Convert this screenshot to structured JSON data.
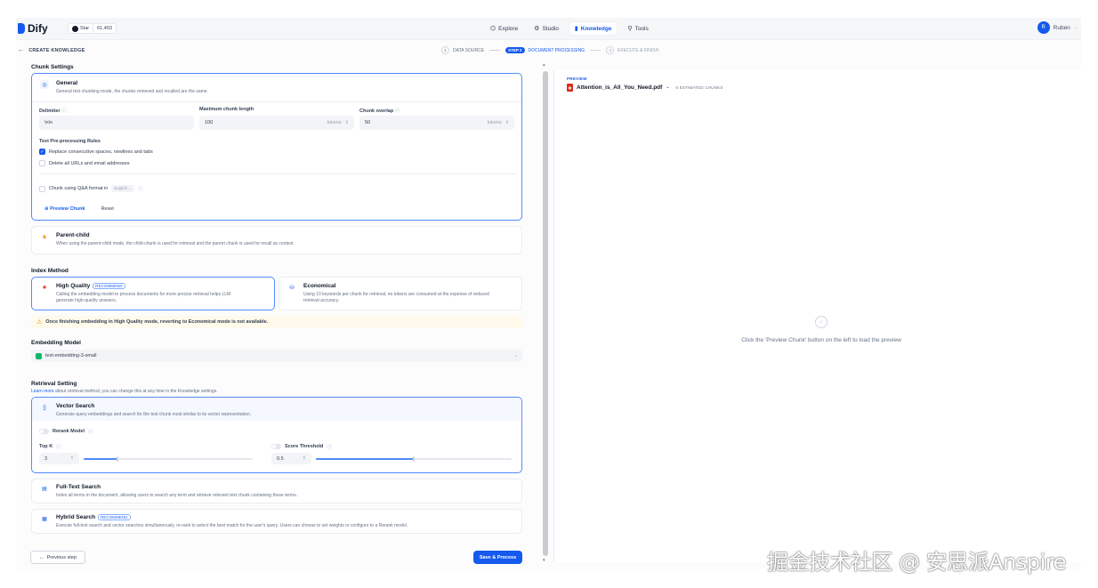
{
  "app": {
    "logo_text": "Dify",
    "star_label": "Star",
    "star_count": "61,493"
  },
  "nav": {
    "items": [
      {
        "label": "Explore",
        "icon": "compass-icon"
      },
      {
        "label": "Studio",
        "icon": "studio-icon"
      },
      {
        "label": "Knowledge",
        "icon": "book-icon",
        "active": true
      },
      {
        "label": "Tools",
        "icon": "tools-icon"
      }
    ]
  },
  "user": {
    "initial": "R",
    "name": "Ruben"
  },
  "header": {
    "back_label": "CREATE KNOWLEDGE"
  },
  "steps": [
    {
      "num": "1",
      "label": "DATA SOURCE"
    },
    {
      "badge": "STEP 2",
      "label": "DOCUMENT PROCESSING"
    },
    {
      "num": "3",
      "label": "EXECUTE & FINISH"
    }
  ],
  "chunk_settings": {
    "title": "Chunk Settings",
    "general": {
      "title": "General",
      "desc": "General text chunking mode, the chunks retrieved and recalled are the same."
    },
    "delimiter": {
      "label": "Delimiter",
      "value": "\\n\\n"
    },
    "max_length": {
      "label": "Maximum chunk length",
      "value": "100",
      "unit": "tokens"
    },
    "overlap": {
      "label": "Chunk overlap",
      "value": "50",
      "unit": "tokens"
    },
    "preprocess_title": "Text Pre-processing Rules",
    "rule_spaces": "Replace consecutive spaces, newlines and tabs",
    "rule_urls": "Delete all URLs and email addresses",
    "qa_label": "Chunk using Q&A format in",
    "qa_lang": "English",
    "preview_btn": "Preview Chunk",
    "reset_btn": "Reset",
    "parent_child": {
      "title": "Parent-child",
      "desc": "When using the parent-child mode, the child-chunk is used for retrieval and the parent chunk is used for recall as context."
    }
  },
  "index_method": {
    "title": "Index Method",
    "high_quality": {
      "title": "High Quality",
      "badge": "RECOMMEND",
      "desc1": "Calling the embedding model to process documents for more precise retrieval helps LLM",
      "desc2": "generate high-quality answers."
    },
    "economical": {
      "title": "Economical",
      "desc1": "Using 10 keywords per chunk for retrieval, no tokens are consumed at the expense of reduced",
      "desc2": "retrieval accuracy."
    },
    "warning": "Once finishing embedding in High Quality mode, reverting to Economical mode is not available."
  },
  "embedding": {
    "title": "Embedding Model",
    "model": "text-embedding-3-small"
  },
  "retrieval": {
    "title": "Retrieval Setting",
    "learn_more": "Learn more",
    "subtitle": " about retrieval method, you can change this at any time in the Knowledge settings.",
    "vector": {
      "title": "Vector Search",
      "desc": "Generate query embeddings and search for the text chunk most similar to its vector representation."
    },
    "rerank_label": "Rerank Model",
    "topk_label": "Top K",
    "topk_value": "3",
    "topk_fraction": 0.2,
    "score_label": "Score Threshold",
    "score_value": "0.5",
    "score_fraction": 0.5,
    "fulltext": {
      "title": "Full-Text Search",
      "desc": "Index all terms in the document, allowing users to search any term and retrieve relevant text chunk containing those terms."
    },
    "hybrid": {
      "title": "Hybrid Search",
      "badge": "RECOMMEND",
      "desc": "Execute full-text search and vector searches simultaneously, re-rank to select the best match for the user's query. Users can choose to set weights or configure to a Rerank model."
    }
  },
  "footer": {
    "prev_btn": "Previous step",
    "save_btn": "Save & Process"
  },
  "preview": {
    "label": "PREVIEW",
    "file": "Attention_is_All_You_Need.pdf",
    "chunks": "0 ESTIMATED CHUNKS",
    "empty_text": "Click the 'Preview Chunk' button on the left to load the preview"
  },
  "watermark": "掘金技术社区 @ 安思派Anspire",
  "colors": {
    "accent": "#155aef",
    "warning": "#f79009",
    "selected_border": "#528bff"
  }
}
